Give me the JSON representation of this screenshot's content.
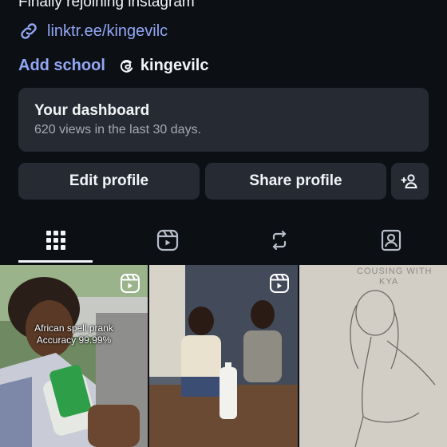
{
  "profile": {
    "bio": "Finally rejoining instagram",
    "link": "linktr.ee/kingevilc",
    "add_school": "Add school",
    "threads_handle": "kingevilc"
  },
  "dashboard": {
    "title": "Your dashboard",
    "subtitle": "620 views in the last 30 days."
  },
  "buttons": {
    "edit": "Edit profile",
    "share": "Share profile",
    "add_person_icon": "add-person-icon"
  },
  "tabs": [
    {
      "icon": "grid-icon",
      "active": true
    },
    {
      "icon": "reels-icon",
      "active": false
    },
    {
      "icon": "reposts-icon",
      "active": false
    },
    {
      "icon": "tagged-icon",
      "active": false
    }
  ],
  "posts": [
    {
      "type": "reel",
      "caption_line1": "African spell prank",
      "caption_line2": "Accuracy 99.99%"
    },
    {
      "type": "reel"
    },
    {
      "type": "image",
      "sketch_line1": "COUSING WITH",
      "sketch_line2": "KYA"
    }
  ],
  "colors": {
    "background": "#0c0f14",
    "card": "#262b33",
    "link": "#93a7f5",
    "text": "#f2f4f7",
    "muted": "#a3aab5"
  }
}
